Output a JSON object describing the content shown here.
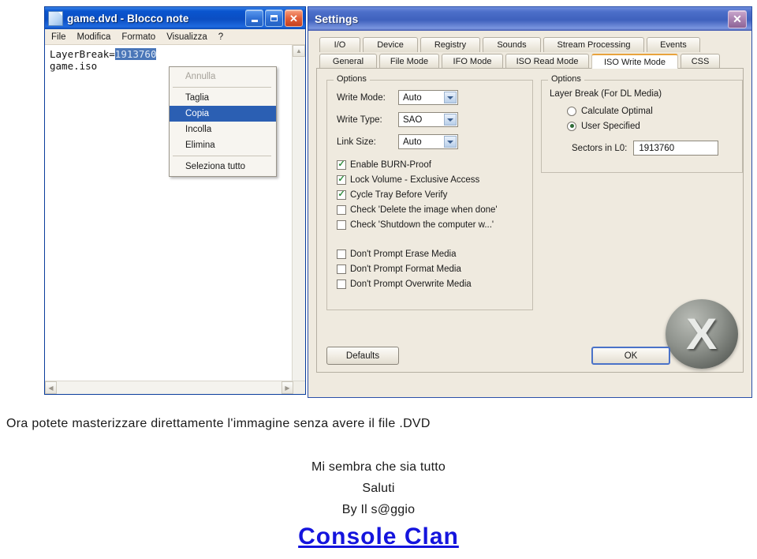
{
  "notepad": {
    "title": "game.dvd - Blocco note",
    "icon": "notepad-document-icon",
    "window_buttons": [
      {
        "name": "minimize",
        "glyph": "_"
      },
      {
        "name": "maximize",
        "glyph": "□"
      },
      {
        "name": "close",
        "glyph": "×"
      }
    ],
    "menu": [
      "File",
      "Modifica",
      "Formato",
      "Visualizza",
      "?"
    ],
    "text": {
      "line1_prefix": "LayerBreak=",
      "line1_selected": "1913760",
      "line2": "game.iso"
    },
    "scroll": {
      "up": "▲",
      "down": "▼",
      "left": "◀",
      "right": "▶"
    }
  },
  "context_menu": {
    "items": [
      {
        "label": "Annulla",
        "state": "disabled"
      },
      {
        "label": "__sep__",
        "state": "separator"
      },
      {
        "label": "Taglia",
        "state": "normal"
      },
      {
        "label": "Copia",
        "state": "selected"
      },
      {
        "label": "Incolla",
        "state": "normal"
      },
      {
        "label": "Elimina",
        "state": "normal"
      },
      {
        "label": "__sep__",
        "state": "separator"
      },
      {
        "label": "Seleziona tutto",
        "state": "normal"
      }
    ]
  },
  "settings": {
    "title": "Settings",
    "close_glyph": "×",
    "tabs_row1": [
      "I/O",
      "Device",
      "Registry",
      "Sounds",
      "Stream Processing",
      "Events"
    ],
    "tabs_row2": [
      "General",
      "File Mode",
      "IFO Mode",
      "ISO Read Mode",
      "ISO Write Mode",
      "CSS"
    ],
    "active_tab": "ISO Write Mode",
    "left_group": {
      "legend": "Options",
      "fields": [
        {
          "label": "Write Mode:",
          "value": "Auto"
        },
        {
          "label": "Write Type:",
          "value": "SAO"
        },
        {
          "label": "Link Size:",
          "value": "Auto"
        }
      ],
      "checkboxes_upper": [
        {
          "label": "Enable BURN-Proof",
          "checked": true
        },
        {
          "label": "Lock Volume - Exclusive Access",
          "checked": true
        },
        {
          "label": "Cycle Tray Before Verify",
          "checked": true
        },
        {
          "label": "Check 'Delete the image when done'",
          "checked": false
        },
        {
          "label": "Check 'Shutdown the computer w...'",
          "checked": false
        }
      ],
      "checkboxes_lower": [
        {
          "label": "Don't Prompt Erase Media",
          "checked": false
        },
        {
          "label": "Don't Prompt Format Media",
          "checked": false
        },
        {
          "label": "Don't Prompt Overwrite Media",
          "checked": false
        }
      ],
      "check_glyph": "✓"
    },
    "right_group": {
      "legend": "Options",
      "heading": "Layer Break (For DL Media)",
      "radios": [
        {
          "label": "Calculate Optimal",
          "selected": false
        },
        {
          "label": "User Specified",
          "selected": true
        }
      ],
      "sectors_label": "Sectors in L0:",
      "sectors_value": "1913760"
    },
    "buttons": {
      "defaults": "Defaults",
      "ok": "OK"
    },
    "watermark": "X"
  },
  "caption": {
    "line1": "Ora potete masterizzare direttamente l'immagine senza avere il file .DVD",
    "line2": "Mi sembra che sia tutto",
    "line3": "Saluti",
    "line4": "By Il s@ggio",
    "link": "Console Clan"
  },
  "colors": {
    "titlebar_blue": "#0b4ec2",
    "settings_titlebar": "#4c6fc9",
    "selection_blue": "#4a76b8",
    "menu_highlight": "#2b5fb3",
    "active_tab_accent": "#e8a33d",
    "link_blue": "#1414dd",
    "dialog_bg": "#efeadf"
  }
}
